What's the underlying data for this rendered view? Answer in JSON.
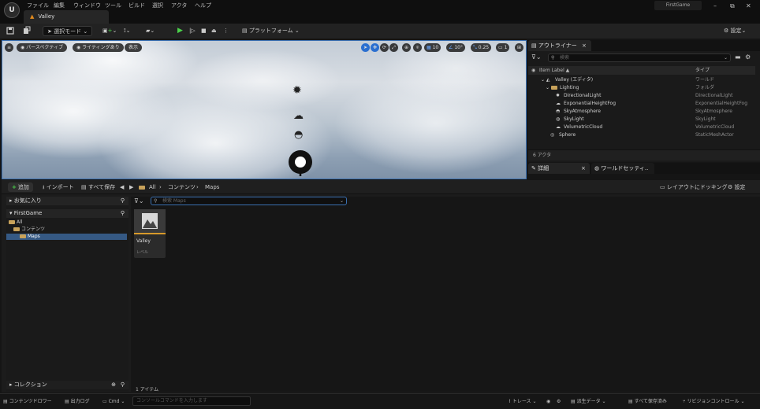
{
  "app": {
    "logo": "U",
    "menu": [
      "ファイル",
      "編集",
      "ウィンドウ",
      "ツール",
      "ビルド",
      "選択",
      "アクタ",
      "ヘルプ"
    ],
    "level_tab": "Valley",
    "project_name": "FirstGame",
    "window_buttons": [
      "–",
      "⧉",
      "✕"
    ]
  },
  "toolbar": {
    "mode_label": "選択モード",
    "platform_label": "プラットフォーム",
    "settings_label": "設定"
  },
  "viewport": {
    "perspective_label": "パースペクティブ",
    "lighting_label": "ライティングあり",
    "show_label": "表示",
    "grid_snap_value": "10",
    "rotation_snap_value": "10°",
    "scale_snap_value": "0.25",
    "camera_speed_value": "1"
  },
  "outliner": {
    "tab_label": "アウトライナー",
    "search_placeholder": "検索",
    "col_label": "Item Label ▲",
    "col_type": "タイプ",
    "rows": [
      {
        "label": "Valley (エディタ)",
        "type": "ワールド"
      },
      {
        "label": "Lighting",
        "type": "フォルダ"
      },
      {
        "label": "DirectionalLight",
        "type": "DirectionalLight"
      },
      {
        "label": "ExponentialHeightFog",
        "type": "ExponentialHeightFog"
      },
      {
        "label": "SkyAtmosphere",
        "type": "SkyAtmosphere"
      },
      {
        "label": "SkyLight",
        "type": "SkyLight"
      },
      {
        "label": "VolumetricCloud",
        "type": "VolumetricCloud"
      },
      {
        "label": "Sphere",
        "type": "StaticMeshActor"
      }
    ],
    "actor_count": "6 アクタ"
  },
  "details": {
    "tab_details": "詳細",
    "tab_world": "ワールドセッティ.."
  },
  "content_browser": {
    "add_label": "追加",
    "import_label": "インポート",
    "save_all_label": "すべて保存",
    "breadcrumb": [
      "All",
      "コンテンツ",
      "Maps"
    ],
    "dock_label": "レイアウトにドッキング",
    "settings_label": "設定",
    "favorites_label": "お気に入り",
    "project_label": "FirstGame",
    "folders": [
      "All",
      "コンテンツ",
      "Maps"
    ],
    "collections_label": "コレクション",
    "search_placeholder": "検索 Maps",
    "asset": {
      "name": "Valley",
      "type": "レベル"
    },
    "item_count": "1 アイテム"
  },
  "statusbar": {
    "content_drawer": "コンテンツドロワー",
    "output_log": "出力ログ",
    "cmd_label": "Cmd",
    "cmd_placeholder": "コンソールコマンドを入力します",
    "trace_label": "トレース",
    "derived_data_label": "派生データ",
    "saved_label": "すべて保存済み",
    "source_control_label": "リビジョンコントロール"
  }
}
